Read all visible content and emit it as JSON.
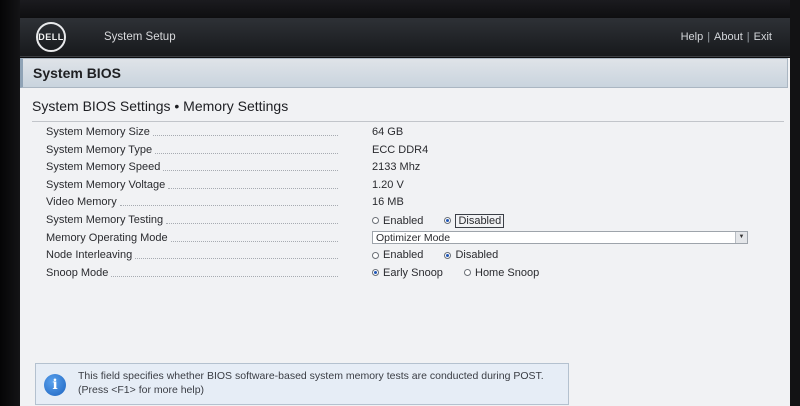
{
  "header": {
    "logo": "DELL",
    "app_title": "System Setup",
    "links": [
      "Help",
      "About",
      "Exit"
    ],
    "separator": "|"
  },
  "section": {
    "title": "System BIOS"
  },
  "page": {
    "heading": "System BIOS Settings • Memory Settings"
  },
  "settings": [
    {
      "label": "System Memory Size",
      "value": "64 GB"
    },
    {
      "label": "System Memory Type",
      "value": "ECC DDR4"
    },
    {
      "label": "System Memory Speed",
      "value": "2133 Mhz"
    },
    {
      "label": "System Memory Voltage",
      "value": "1.20 V"
    },
    {
      "label": "Video Memory",
      "value": "16 MB"
    },
    {
      "label": "System Memory Testing",
      "options": [
        "Enabled",
        "Disabled"
      ],
      "selected": "Disabled"
    },
    {
      "label": "Memory Operating Mode",
      "value": "Optimizer Mode"
    },
    {
      "label": "Node Interleaving",
      "options": [
        "Enabled",
        "Disabled"
      ],
      "selected": "Disabled"
    },
    {
      "label": "Snoop Mode",
      "options": [
        "Early Snoop",
        "Home Snoop"
      ],
      "selected": "Early Snoop"
    }
  ],
  "help": {
    "icon": "info-icon",
    "text": "This field specifies whether BIOS software-based system memory tests are conducted during POST. (Press <F1> for more help)"
  },
  "colors": {
    "header_bg": "#1f2226",
    "panel_bg": "#f1f2f4",
    "section_bar": "#cfd9e3",
    "radio_selected": "#1f56b6",
    "help_bg": "#e6edf6"
  }
}
